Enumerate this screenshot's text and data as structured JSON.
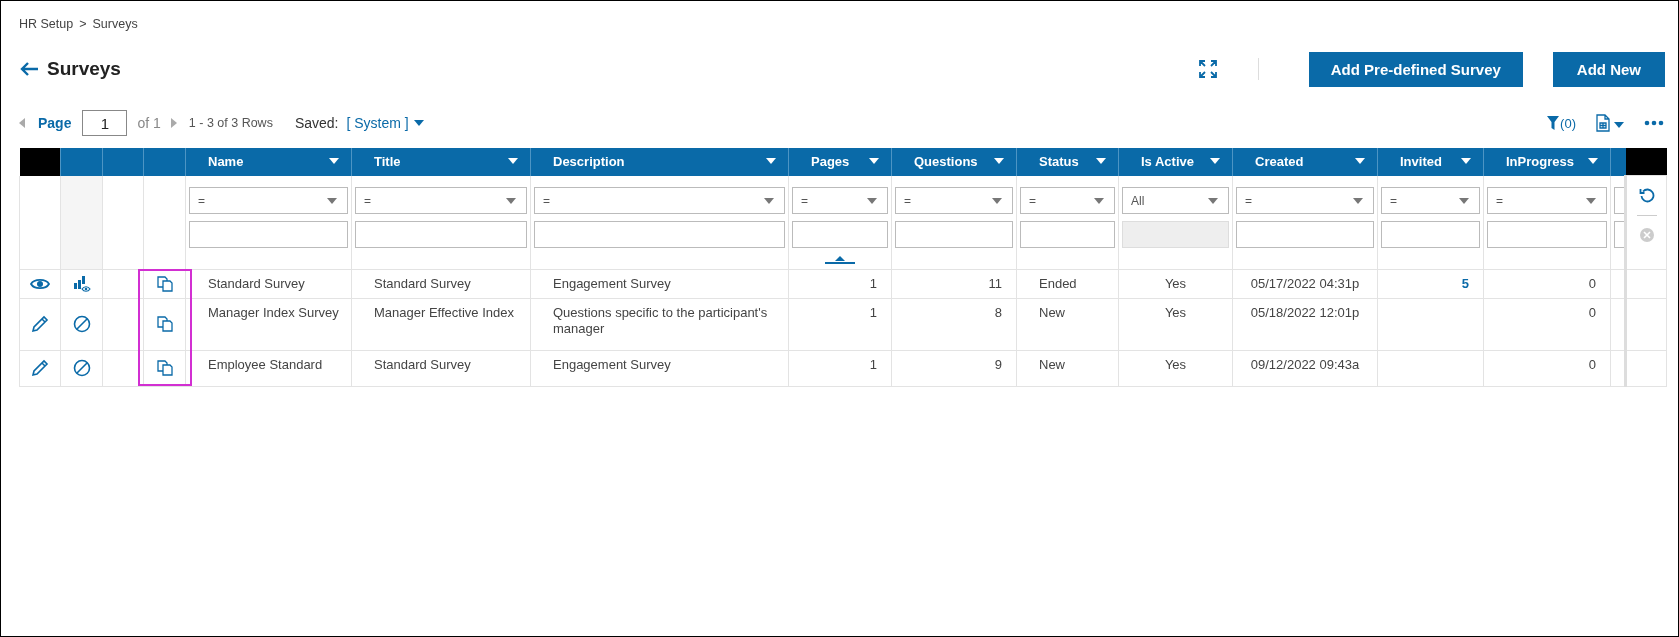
{
  "breadcrumb": {
    "items": [
      {
        "label": "HR Setup"
      },
      {
        "label": "Surveys"
      }
    ],
    "separator": ">"
  },
  "title": "Surveys",
  "actions": [
    {
      "label": "Add Pre-defined Survey"
    },
    {
      "label": "Add New"
    }
  ],
  "pager": {
    "label": "Page",
    "value": "1",
    "of": "of 1",
    "rows": "1 - 3 of 3 Rows"
  },
  "saved": {
    "label": "Saved:",
    "value": "[ System ]"
  },
  "filter_count": "(0)",
  "table": {
    "copy_column_highlighted": true,
    "columns": [
      {
        "label": "Name",
        "kind": "text",
        "filter": "=",
        "filter_enabled": true,
        "sorted": false
      },
      {
        "label": "Title",
        "kind": "text",
        "filter": "=",
        "filter_enabled": true,
        "sorted": false
      },
      {
        "label": "Description",
        "kind": "text",
        "filter": "=",
        "filter_enabled": true,
        "sorted": false
      },
      {
        "label": "Pages",
        "kind": "number",
        "filter": "=",
        "filter_enabled": true,
        "sorted": true
      },
      {
        "label": "Questions",
        "kind": "number",
        "filter": "=",
        "filter_enabled": true,
        "sorted": false
      },
      {
        "label": "Status",
        "kind": "text",
        "filter": "=",
        "filter_enabled": true,
        "sorted": false
      },
      {
        "label": "Is Active",
        "kind": "flag",
        "filter": "All",
        "filter_enabled": false,
        "sorted": false
      },
      {
        "label": "Created",
        "kind": "date",
        "filter": "=",
        "filter_enabled": true,
        "sorted": false
      },
      {
        "label": "Invited",
        "kind": "link",
        "filter": "=",
        "filter_enabled": true,
        "sorted": false
      },
      {
        "label": "InProgress",
        "kind": "number",
        "filter": "=",
        "filter_enabled": true,
        "sorted": false
      }
    ],
    "rows": [
      {
        "actions": [
          {
            "kind": "view"
          },
          {
            "kind": "report"
          }
        ],
        "cells": [
          "Standard Survey",
          "Standard Survey",
          "Engagement Survey",
          "1",
          "11",
          "Ended",
          "Yes",
          "05/17/2022 04:31p",
          "5",
          "0"
        ]
      },
      {
        "actions": [
          {
            "kind": "edit"
          },
          {
            "kind": "blocked"
          }
        ],
        "cells": [
          "Manager Index Survey",
          "Manager Effective Index",
          "Questions specific to the participant's manager",
          "1",
          "8",
          "New",
          "Yes",
          "05/18/2022 12:01p",
          "",
          "0"
        ]
      },
      {
        "actions": [
          {
            "kind": "edit"
          },
          {
            "kind": "blocked"
          }
        ],
        "cells": [
          "Employee Standard",
          "Standard Survey",
          "Engagement Survey",
          "1",
          "9",
          "New",
          "Yes",
          "09/12/2022 09:43a",
          "",
          "0"
        ]
      }
    ],
    "clear_filters_enabled": false
  }
}
